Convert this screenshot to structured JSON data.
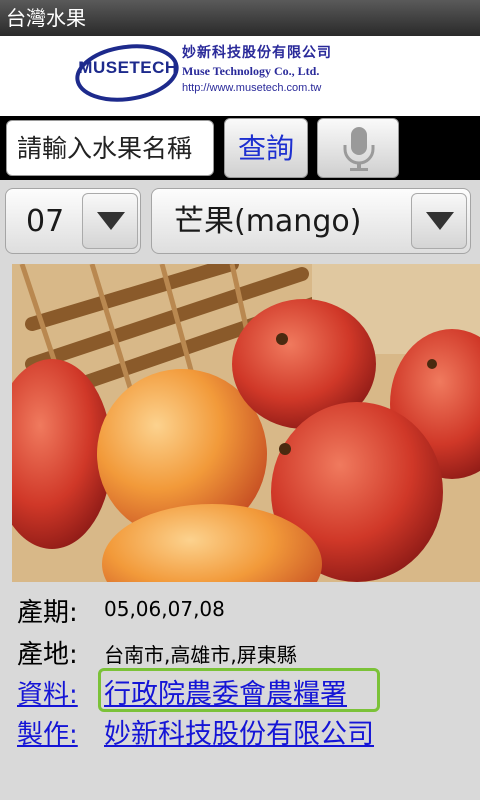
{
  "app": {
    "title": "台灣水果"
  },
  "banner": {
    "logo_text": "MUSETECH",
    "company_cn": "妙新科技股份有限公司",
    "company_en": "Muse Technology Co., Ltd.",
    "url": "http://www.musetech.com.tw"
  },
  "search": {
    "placeholder": "請輸入水果名稱",
    "button_label": "查詢",
    "mic_icon": "microphone-icon"
  },
  "filters": {
    "month": "07",
    "fruit": "芒果(mango)",
    "dropdown_icon": "triangle-down-icon"
  },
  "photo": {
    "subject": "mango-photo"
  },
  "info": {
    "season_label": "產期:",
    "season_value": "05,06,07,08",
    "origin_label": "產地:",
    "origin_value": "台南市,高雄市,屏東縣",
    "source_label": "資料:",
    "source_value": "行政院農委會農糧署",
    "maker_label": "製作:",
    "maker_value": "妙新科技股份有限公司"
  },
  "colors": {
    "link": "#1515d6",
    "focus": "#7bc238",
    "brand": "#1d2a8c"
  }
}
